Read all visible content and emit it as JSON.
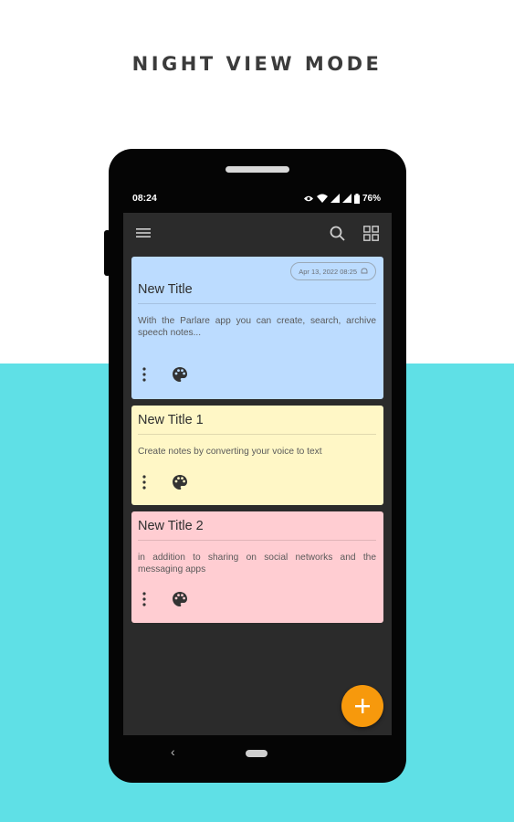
{
  "headline": "NIGHT VIEW MODE",
  "status_bar": {
    "time": "08:24",
    "battery": "76%"
  },
  "notes": [
    {
      "date": "Apr 13, 2022  08:25",
      "title": "New Title",
      "body": "With the Parlare app you can create, search, archive speech notes...",
      "color": "#bcdcff"
    },
    {
      "title": "New Title 1",
      "body": "Create notes by converting your voice to text",
      "color": "#fff7c6"
    },
    {
      "title": "New Title 2",
      "body": "in addition to sharing on social networks and the messaging apps",
      "color": "#ffcdd2"
    }
  ],
  "icons": {
    "menu": "hamburger-menu-icon",
    "search": "search-icon",
    "grid": "grid-view-icon",
    "more": "more-vertical-icon",
    "palette": "palette-icon",
    "alarm": "alarm-icon",
    "add": "plus-icon",
    "back": "back-icon",
    "home": "home-pill-icon"
  },
  "colors": {
    "background": "#ffffff",
    "band": "#5fe0e6",
    "phone": "#050505",
    "screen": "#2b2b2b",
    "fab": "#f7990c"
  }
}
